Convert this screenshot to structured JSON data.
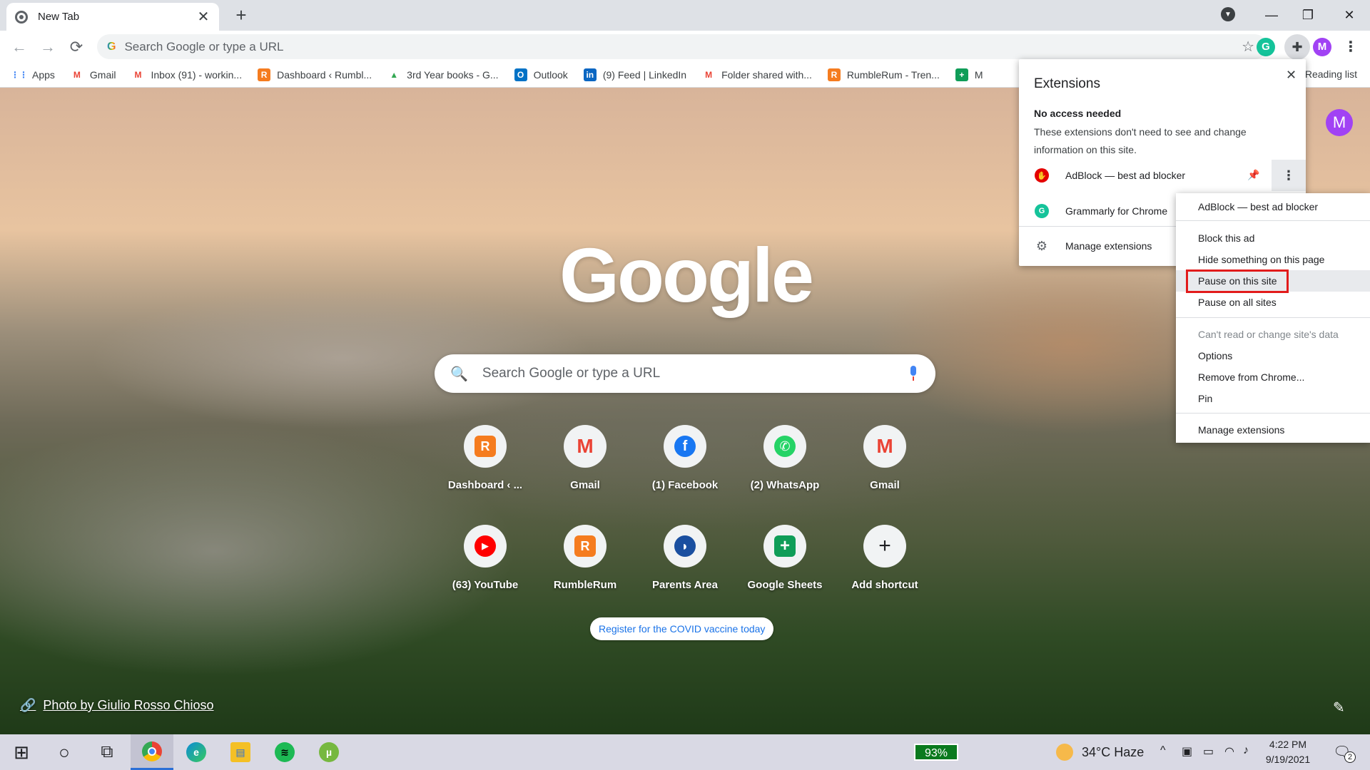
{
  "tab": {
    "title": "New Tab",
    "close": "✕",
    "new_tab": "+"
  },
  "window": {
    "minimize": "—",
    "maximize": "❐",
    "close": "✕",
    "tab_search": "▼"
  },
  "toolbar": {
    "back": "←",
    "forward": "→",
    "reload": "⟳",
    "omnibox_placeholder": "Search Google or type a URL",
    "star": "☆",
    "grammarly": "G",
    "extensions": "✚",
    "profile": "M",
    "menu": "⋮"
  },
  "bookmarks": [
    {
      "label": "Apps",
      "icon": "apps-grid",
      "icon_text": "⋮⋮",
      "color": "#4285f4"
    },
    {
      "label": "Gmail",
      "icon": "gmail",
      "icon_text": "M",
      "color": "#ea4335"
    },
    {
      "label": "Inbox (91) - workin...",
      "icon": "gmail",
      "icon_text": "M",
      "color": "#ea4335"
    },
    {
      "label": "Dashboard ‹ Rumbl...",
      "icon": "rumblerum",
      "icon_text": "R",
      "color": "#f57c1f"
    },
    {
      "label": "3rd Year books - G...",
      "icon": "drive",
      "icon_text": "▲",
      "color": "#34a853"
    },
    {
      "label": "Outlook",
      "icon": "outlook",
      "icon_text": "O",
      "color": "#0072c6"
    },
    {
      "label": "(9) Feed | LinkedIn",
      "icon": "linkedin",
      "icon_text": "in",
      "color": "#0a66c2"
    },
    {
      "label": "Folder shared with...",
      "icon": "gmail",
      "icon_text": "M",
      "color": "#ea4335"
    },
    {
      "label": "RumbleRum - Tren...",
      "icon": "rumblerum",
      "icon_text": "R",
      "color": "#f57c1f"
    },
    {
      "label": "M",
      "icon": "sheets",
      "icon_text": "+",
      "color": "#0f9d58"
    }
  ],
  "reading_list": "Reading list",
  "ntp": {
    "avatar": "M",
    "logo": "Google",
    "search_placeholder": "Search Google or type a URL",
    "search_icon": "🔍",
    "shortcuts_row1": [
      {
        "label": "Dashboard ‹ ...",
        "icon": "rumblerum",
        "glyph": "R",
        "color": "#f57c1f"
      },
      {
        "label": "Gmail",
        "icon": "gmail",
        "glyph": "M",
        "color": "#ea4335"
      },
      {
        "label": "(1) Facebook",
        "icon": "facebook",
        "glyph": "f",
        "color": "#1877f2"
      },
      {
        "label": "(2) WhatsApp",
        "icon": "whatsapp",
        "glyph": "✆",
        "color": "#25d366"
      },
      {
        "label": "Gmail",
        "icon": "gmail",
        "glyph": "M",
        "color": "#ea4335"
      }
    ],
    "shortcuts_row2": [
      {
        "label": "(63) YouTube",
        "icon": "youtube",
        "glyph": "▶",
        "color": "#ff0000"
      },
      {
        "label": "RumbleRum",
        "icon": "rumblerum",
        "glyph": "R",
        "color": "#f57c1f"
      },
      {
        "label": "Parents Area",
        "icon": "parents-area",
        "glyph": "◗",
        "color": "#1a4fa0"
      },
      {
        "label": "Google Sheets",
        "icon": "sheets",
        "glyph": "+",
        "color": "#0f9d58"
      },
      {
        "label": "Add shortcut",
        "icon": "add",
        "glyph": "+",
        "color": "#f1f3f4"
      }
    ],
    "promo": "Register for the COVID vaccine today",
    "attribution": "Photo by Giulio Rosso Chioso",
    "link_icon": "🔗",
    "customize_icon": "✎"
  },
  "extensions_popup": {
    "title": "Extensions",
    "close": "✕",
    "section": "No access needed",
    "description": "These extensions don't need to see and change information on this site.",
    "items": [
      {
        "label": "AdBlock — best ad blocker",
        "icon": "adblock",
        "glyph": "✋",
        "color": "#e40000"
      },
      {
        "label": "Grammarly for Chrome",
        "icon": "grammarly",
        "glyph": "G",
        "color": "#15c39a"
      }
    ],
    "pin": "📌",
    "more": "⋮",
    "manage": "Manage extensions",
    "manage_icon": "⚙"
  },
  "context_menu": {
    "items": [
      {
        "label": "AdBlock — best ad blocker",
        "disabled": false
      },
      {
        "label": "Block this ad",
        "disabled": false
      },
      {
        "label": "Hide something on this page",
        "disabled": false
      },
      {
        "label": "Pause on this site",
        "disabled": false,
        "highlighted": true
      },
      {
        "label": "Pause on all sites",
        "disabled": false
      },
      {
        "label": "Can't read or change site's data",
        "disabled": true
      },
      {
        "label": "Options",
        "disabled": false
      },
      {
        "label": "Remove from Chrome...",
        "disabled": false
      },
      {
        "label": "Pin",
        "disabled": false
      },
      {
        "label": "Manage extensions",
        "disabled": false
      }
    ]
  },
  "taskbar": {
    "start": "⊞",
    "search": "○",
    "task_view": "⧉",
    "apps": [
      {
        "name": "chrome",
        "glyph": "◉",
        "color": "#ea4335",
        "active": true
      },
      {
        "name": "edge",
        "glyph": "e",
        "color": "#0c8cd6",
        "active": false
      },
      {
        "name": "file-explorer",
        "glyph": "▤",
        "color": "#f4c025",
        "active": false
      },
      {
        "name": "spotify",
        "glyph": "≋",
        "color": "#1db954",
        "active": false
      },
      {
        "name": "utorrent",
        "glyph": "µ",
        "color": "#76b83f",
        "active": false
      }
    ],
    "battery": "93%",
    "weather": "34°C  Haze",
    "tray_chevron": "^",
    "time": "4:22 PM",
    "date": "9/19/2021",
    "notifications_icon": "🗨",
    "notifications_count": "2"
  }
}
